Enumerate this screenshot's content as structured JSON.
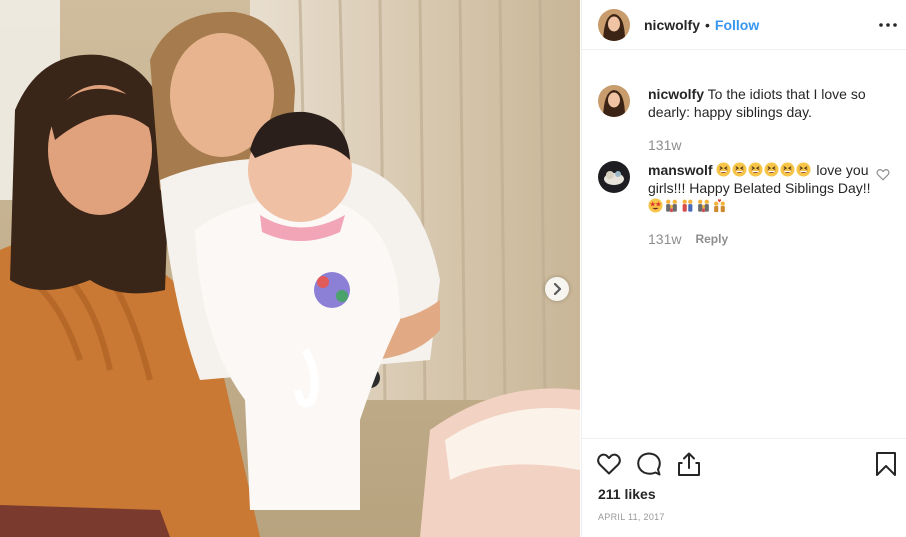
{
  "post": {
    "username": "nicwolfy",
    "separator": "•",
    "follow_label": "Follow",
    "more_icon": "more-horizontal-icon",
    "next_icon": "chevron-right-icon"
  },
  "caption": {
    "username": "nicwolfy",
    "text": "To the idiots that I love so dearly: happy siblings day.",
    "age": "131w"
  },
  "comments": [
    {
      "username": "manswolf",
      "text_before": "love you girls!!! Happy Belated Siblings Day!!",
      "age": "131w",
      "reply_label": "Reply",
      "emojis_leading": [
        "grinning-squint-face",
        "grinning-squint-face",
        "grinning-squint-face",
        "grinning-squint-face",
        "grinning-squint-face",
        "grinning-squint-face"
      ],
      "emojis_trailing": [
        "star-struck-face",
        "family-icon",
        "couple-icon",
        "family-icon",
        "couple-heart-icon"
      ]
    }
  ],
  "actions": {
    "likes": "211 likes",
    "date": "APRIL 11, 2017",
    "icons": [
      "heart-icon",
      "comment-icon",
      "share-icon",
      "bookmark-icon"
    ]
  },
  "colors": {
    "link_blue": "#3897f0",
    "text": "#262626",
    "muted": "#8e8e8e",
    "border": "#efefef"
  }
}
